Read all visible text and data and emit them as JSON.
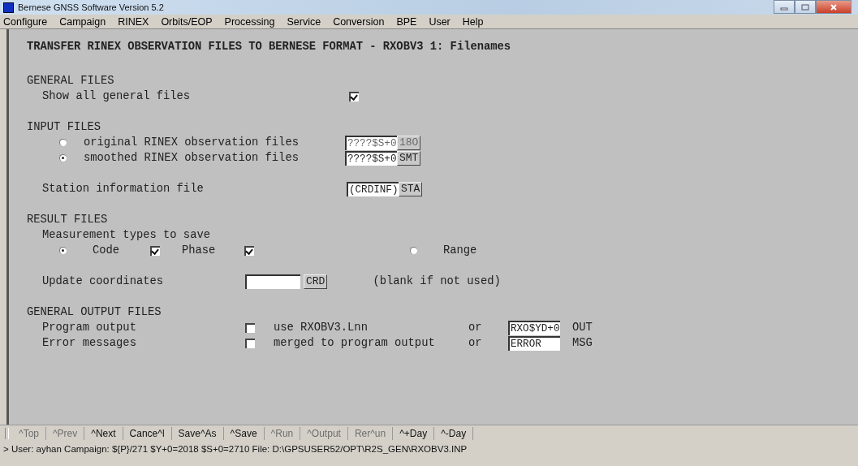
{
  "window": {
    "title": "Bernese GNSS Software Version 5.2"
  },
  "menu": [
    "Configure",
    "Campaign",
    "RINEX",
    "Orbits/EOP",
    "Processing",
    "Service",
    "Conversion",
    "BPE",
    "User",
    "Help"
  ],
  "panel": {
    "title": "TRANSFER RINEX OBSERVATION FILES TO BERNESE FORMAT - RXOBV3 1: Filenames",
    "general_files": {
      "heading": "GENERAL FILES",
      "show_all": {
        "label": "Show all general files",
        "checked": true
      }
    },
    "input_files": {
      "heading": "INPUT FILES",
      "options": [
        {
          "label": "original RINEX observation files",
          "selected": false,
          "value": "????$S+0",
          "button": "18O",
          "disabled": true
        },
        {
          "label": "smoothed RINEX observation files",
          "selected": true,
          "value": "????$S+0",
          "button": "SMT",
          "disabled": false
        }
      ],
      "station": {
        "label": "Station information file",
        "value": "(CRDINF)",
        "button": "STA"
      }
    },
    "result_files": {
      "heading": "RESULT FILES",
      "label": "Measurement types to save",
      "code_phase": {
        "selected": true
      },
      "code": {
        "label": "Code",
        "checked": true
      },
      "phase": {
        "label": "Phase",
        "checked": true
      },
      "range": {
        "label": "Range",
        "selected": false
      },
      "update": {
        "label": "Update coordinates",
        "button": "CRD",
        "note": "(blank if not used)"
      }
    },
    "output_files": {
      "heading": "GENERAL OUTPUT FILES",
      "rows": [
        {
          "label": "Program output",
          "checked": false,
          "option": "use RXOBV3.Lnn",
          "or": "or",
          "value": "RXO$YD+0",
          "ext": "OUT"
        },
        {
          "label": "Error messages",
          "checked": false,
          "option": "merged to program output",
          "or": "or",
          "value": "ERROR",
          "ext": "MSG"
        }
      ]
    }
  },
  "toolbar": [
    {
      "label": "^Top",
      "disabled": true
    },
    {
      "label": "^Prev",
      "disabled": true
    },
    {
      "label": "^Next",
      "disabled": false
    },
    {
      "label": "Cance^l",
      "disabled": false
    },
    {
      "label": "Save^As",
      "disabled": false
    },
    {
      "label": "^Save",
      "disabled": false
    },
    {
      "label": "^Run",
      "disabled": true
    },
    {
      "label": "^Output",
      "disabled": true
    },
    {
      "label": "Rer^un",
      "disabled": true
    },
    {
      "label": "^+Day",
      "disabled": false
    },
    {
      "label": "^-Day",
      "disabled": false
    }
  ],
  "status": "> User: ayhan  Campaign: ${P}/271  $Y+0=2018  $S+0=2710  File: D:\\GPSUSER52/OPT\\R2S_GEN\\RXOBV3.INP"
}
